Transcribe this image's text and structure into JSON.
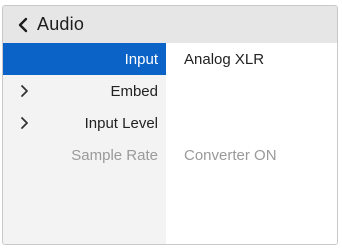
{
  "header": {
    "title": "Audio",
    "back_icon": "chevron-left-icon"
  },
  "menu": [
    {
      "label": "Input",
      "value": "Analog XLR",
      "selected": true,
      "expandable": false,
      "disabled": false
    },
    {
      "label": "Embed",
      "value": "",
      "selected": false,
      "expandable": true,
      "disabled": false
    },
    {
      "label": "Input Level",
      "value": "",
      "selected": false,
      "expandable": true,
      "disabled": false
    },
    {
      "label": "Sample Rate",
      "value": "Converter ON",
      "selected": false,
      "expandable": false,
      "disabled": true
    }
  ],
  "colors": {
    "accent": "#0b63c8",
    "header_bg": "#e6e6e6",
    "panel_bg": "#f3f3f3",
    "disabled_text": "#9a9a9a"
  }
}
